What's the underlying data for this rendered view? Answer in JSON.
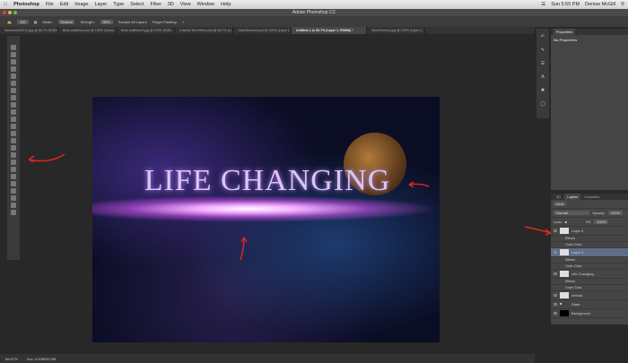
{
  "menubar": {
    "apple": "",
    "app": "Photoshop",
    "items": [
      "File",
      "Edit",
      "Image",
      "Layer",
      "Type",
      "Select",
      "Filter",
      "3D",
      "View",
      "Window",
      "Help"
    ],
    "clock": "Sun 5:55 PM",
    "user": "Denise McGill"
  },
  "window": {
    "title": "Adobe Photoshop CC"
  },
  "options": {
    "mode_label": "Mode:",
    "mode_value": "Normal",
    "strength_label": "Strength:",
    "strength_value": "85%",
    "sample_all": "Sample All Layers",
    "finger_painting": "Finger Painting",
    "brush_size": "100"
  },
  "tabs": [
    "Screenshot2013.jpg @ 66.7% (RGB/8...",
    "Brick wall9mm.psd @ 100% (Gears...",
    "Brick wall9mm2.jpg @ 100% (RGB...",
    "Colorful Text Effect.psd @ 66.7% (Li...",
    "GlowTextured.psd @ 100% (Layer 1...",
    "Untitled-1 @ 66.7% (Layer 1, RGB/8) *",
    "StoneTexture.jpg @ 100% (Layer 1..."
  ],
  "active_tab": 5,
  "canvas": {
    "text": "LIFE CHANGING"
  },
  "status": {
    "zoom": "66.67%",
    "doc": "Doc: 3.00M/39.0M"
  },
  "properties": {
    "tab": "Properties",
    "message": "No Properties"
  },
  "layers_panel": {
    "tabs": [
      "3D",
      "Layers",
      "Channels"
    ],
    "filter": "Kind",
    "blend": "Normal",
    "opacity_label": "Opacity:",
    "opacity": "100%",
    "lock_label": "Lock:",
    "fill_label": "Fill:",
    "fill": "100%",
    "rows": [
      {
        "name": "Layer 4",
        "type": "layer",
        "thumb": "light"
      },
      {
        "name": "Effects",
        "type": "sub"
      },
      {
        "name": "Outer Glow",
        "type": "sub"
      },
      {
        "name": "Layer 3",
        "type": "layer",
        "thumb": "light",
        "selected": true
      },
      {
        "name": "Effects",
        "type": "sub"
      },
      {
        "name": "Outer Glow",
        "type": "sub"
      },
      {
        "name": "Life Changing",
        "type": "layer",
        "thumb": "light"
      },
      {
        "name": "Effects",
        "type": "sub"
      },
      {
        "name": "Outer Glow",
        "type": "sub"
      },
      {
        "name": "nebula",
        "type": "layer",
        "thumb": "light"
      },
      {
        "name": "Stars",
        "type": "layer",
        "thumb": "folder"
      },
      {
        "name": "Background",
        "type": "layer",
        "thumb": "dark"
      }
    ]
  },
  "colors": {
    "annotation_arrow": "#d42a1e",
    "selected_layer": "#5f6e88"
  }
}
